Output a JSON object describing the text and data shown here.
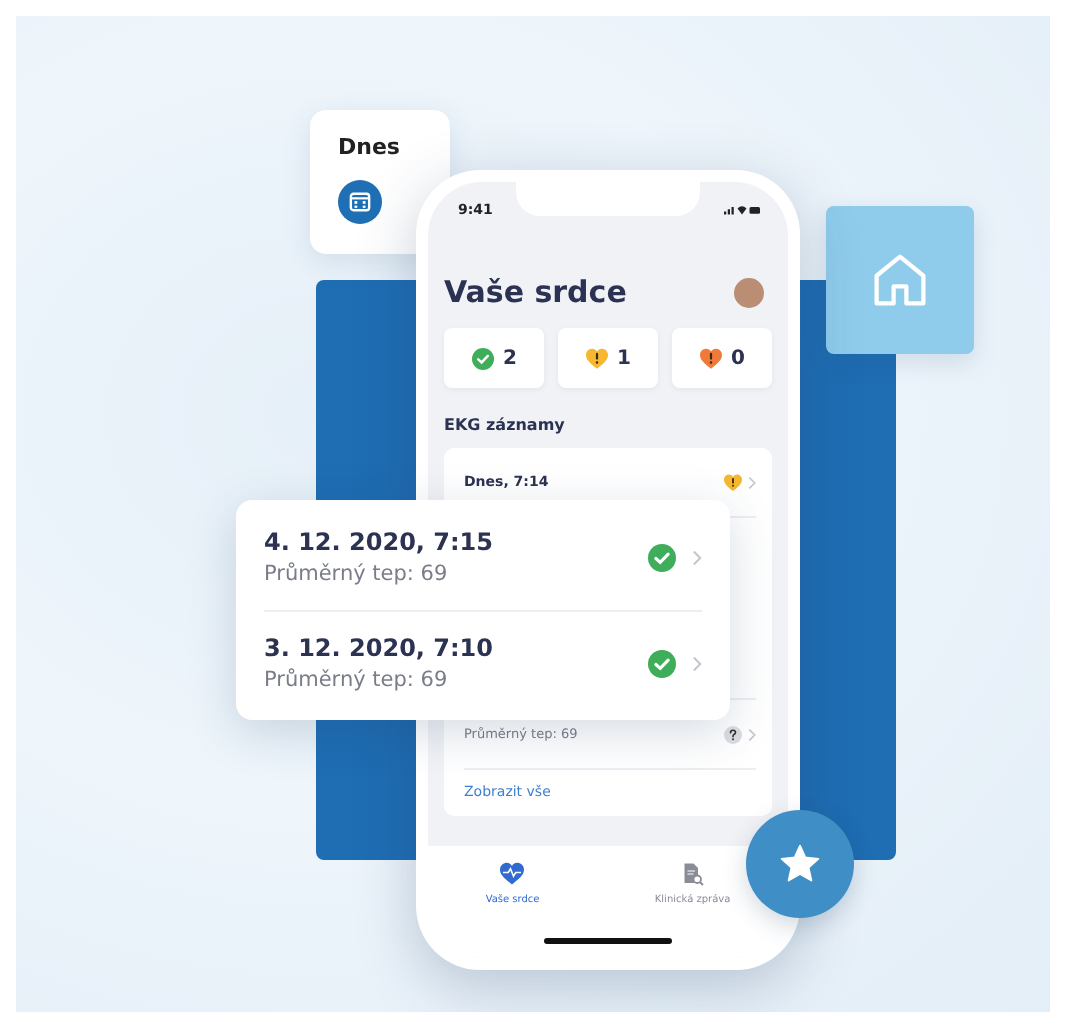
{
  "date_card": {
    "label": "Dnes"
  },
  "phone": {
    "status_bar": {
      "time": "9:41"
    },
    "title": "Vaše srdce",
    "summary": [
      {
        "kind": "ok",
        "count": "2"
      },
      {
        "kind": "warning",
        "count": "1"
      },
      {
        "kind": "alert",
        "count": "0"
      }
    ],
    "section_title": "EKG záznamy",
    "records": [
      {
        "title": "Dnes, 7:14",
        "kind": "warning"
      },
      {
        "subtitle": "Průměrný tep: 69",
        "kind": "unknown"
      }
    ],
    "show_all_link": "Zobrazit vše",
    "tabs": [
      {
        "label": "Vaše srdce",
        "kind": "heart",
        "selected": true
      },
      {
        "label": "Klinická zpráva",
        "kind": "report",
        "selected": false
      }
    ]
  },
  "floating_records": [
    {
      "title": "4. 12. 2020, 7:15",
      "subtitle": "Průměrný tep: 69",
      "kind": "ok"
    },
    {
      "title": "3. 12. 2020, 7:10",
      "subtitle": "Průměrný tep: 69",
      "kind": "ok"
    }
  ]
}
